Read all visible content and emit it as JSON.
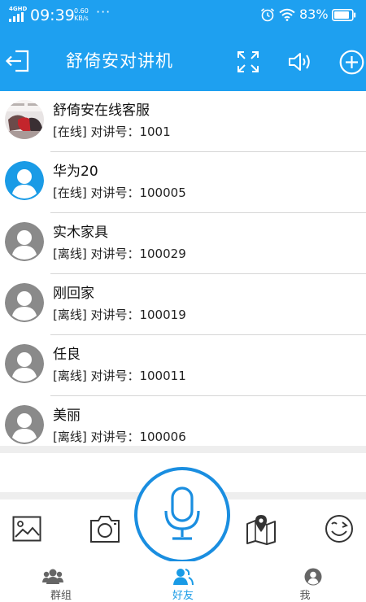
{
  "status_bar": {
    "network": "4GHD",
    "time": "09:39",
    "speed_value": "0.60",
    "speed_unit": "KB/s",
    "more": "···",
    "battery_percent": "83%"
  },
  "header": {
    "title": "舒倚安对讲机",
    "icons": [
      "exit-icon",
      "fullscreen-icon",
      "volume-icon",
      "add-icon"
    ],
    "color": "#1ea0f0"
  },
  "contacts": [
    {
      "name": "舒倚安在线客服",
      "status": "[在线] 对讲号：1001",
      "avatar": "photo"
    },
    {
      "name": "华为20",
      "status": "[在线] 对讲号：100005",
      "avatar": "online"
    },
    {
      "name": "实木家具",
      "status": "[离线] 对讲号：100029",
      "avatar": "offline"
    },
    {
      "name": "刚回家",
      "status": "[离线] 对讲号：100019",
      "avatar": "offline"
    },
    {
      "name": "任良",
      "status": "[离线] 对讲号：100011",
      "avatar": "offline"
    },
    {
      "name": "美丽",
      "status": "[离线] 对讲号：100006",
      "avatar": "offline"
    }
  ],
  "toolbar": {
    "icons": [
      "image-icon",
      "camera-icon",
      "microphone-icon",
      "map-location-icon",
      "emoji-icon"
    ]
  },
  "nav": {
    "items": [
      {
        "label": "群组",
        "icon": "group-icon",
        "active": false
      },
      {
        "label": "好友",
        "icon": "friends-icon",
        "active": true
      },
      {
        "label": "我",
        "icon": "me-icon",
        "active": false
      }
    ]
  },
  "colors": {
    "accent": "#1ea0f0",
    "online_avatar": "#1a9be6",
    "offline_avatar": "#8a8a8a"
  }
}
